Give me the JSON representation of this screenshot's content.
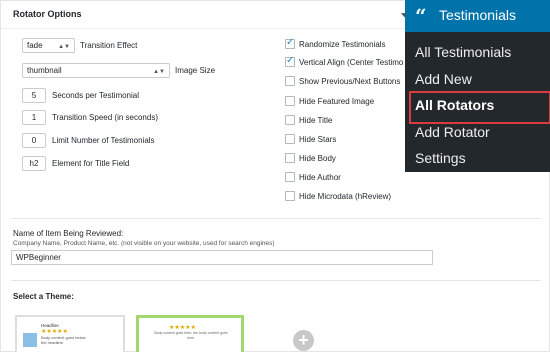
{
  "panel": {
    "title": "Rotator Options"
  },
  "left_options": {
    "transition_effect": {
      "value": "fade",
      "label": "Transition Effect"
    },
    "image_size": {
      "value": "thumbnail",
      "label": "Image Size"
    },
    "seconds": {
      "value": "5",
      "label": "Seconds per Testimonial"
    },
    "speed": {
      "value": "1",
      "label": "Transition Speed (in seconds)"
    },
    "limit": {
      "value": "0",
      "label": "Limit Number of Testimonials"
    },
    "title_el": {
      "value": "h2",
      "label": "Element for Title Field"
    }
  },
  "checkboxes": [
    {
      "label": "Randomize Testimonials",
      "checked": true
    },
    {
      "label": "Vertical Align (Center Testimo",
      "checked": true
    },
    {
      "label": "Show Previous/Next Buttons",
      "checked": false
    },
    {
      "label": "Hide Featured Image",
      "checked": false
    },
    {
      "label": "Hide Title",
      "checked": false
    },
    {
      "label": "Hide Stars",
      "checked": false
    },
    {
      "label": "Hide Body",
      "checked": false
    },
    {
      "label": "Hide Author",
      "checked": false
    },
    {
      "label": "Hide Microdata (hReview)",
      "checked": false
    }
  ],
  "review": {
    "label": "Name of Item Being Reviewed:",
    "help": "Company Name, Product Name, etc. (not visible on your website, used for search engines)",
    "value": "WPBeginner"
  },
  "theme": {
    "label": "Select a Theme:",
    "t1_head": "Headline",
    "t1_stars": "★★★★★",
    "t1_body": "Body content goes below the headline.",
    "t2_stars": "★★★★★",
    "t2_body": "Body content goes here, the body content goes here."
  },
  "menu": {
    "title": "Testimonials",
    "items": [
      "All Testimonials",
      "Add New",
      "All Rotators",
      "Add Rotator",
      "Settings"
    ],
    "current_index": 2
  }
}
